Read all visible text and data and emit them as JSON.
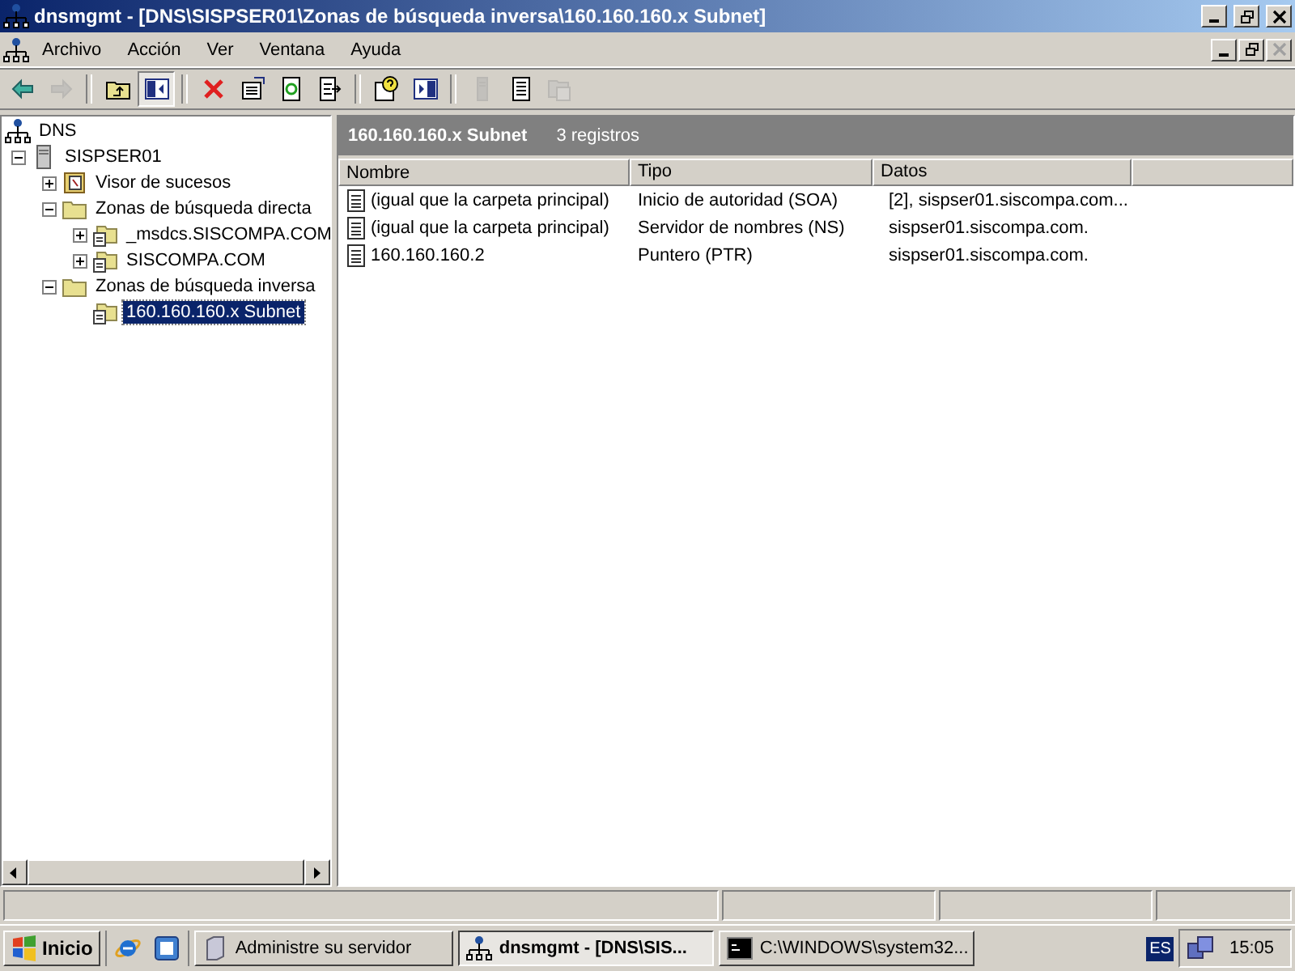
{
  "window": {
    "title": "dnsmgmt - [DNS\\SISPSER01\\Zonas de búsqueda inversa\\160.160.160.x Subnet]"
  },
  "menu": [
    "Archivo",
    "Acción",
    "Ver",
    "Ventana",
    "Ayuda"
  ],
  "toolbar": [
    {
      "kind": "back",
      "disabled": false
    },
    {
      "kind": "forward",
      "disabled": true
    },
    {
      "kind": "sep"
    },
    {
      "kind": "up",
      "disabled": false
    },
    {
      "kind": "tree",
      "disabled": false
    },
    {
      "kind": "sep"
    },
    {
      "kind": "delete",
      "disabled": false
    },
    {
      "kind": "properties",
      "disabled": false
    },
    {
      "kind": "refresh",
      "disabled": false
    },
    {
      "kind": "export",
      "disabled": false
    },
    {
      "kind": "sep"
    },
    {
      "kind": "help",
      "disabled": false
    },
    {
      "kind": "action",
      "disabled": false
    },
    {
      "kind": "sep"
    },
    {
      "kind": "server",
      "disabled": true
    },
    {
      "kind": "record",
      "disabled": false
    },
    {
      "kind": "domain",
      "disabled": true
    }
  ],
  "tree": [
    {
      "label": "DNS",
      "kind": "dns",
      "selected": false,
      "children": [
        {
          "label": "SISPSER01",
          "kind": "server",
          "expanded": true,
          "selected": false,
          "children": [
            {
              "label": "Visor de sucesos",
              "kind": "events",
              "expanded": false,
              "selected": false
            },
            {
              "label": "Zonas de búsqueda directa",
              "kind": "folder",
              "expanded": true,
              "selected": false,
              "children": [
                {
                  "label": "_msdcs.SISCOMPA.COM",
                  "kind": "zone",
                  "expanded": false,
                  "selected": false
                },
                {
                  "label": "SISCOMPA.COM",
                  "kind": "zone",
                  "expanded": false,
                  "selected": false
                }
              ]
            },
            {
              "label": "Zonas de búsqueda inversa",
              "kind": "folder",
              "expanded": true,
              "selected": false,
              "children": [
                {
                  "label": "160.160.160.x Subnet",
                  "kind": "zone",
                  "selected": true
                }
              ]
            }
          ]
        }
      ]
    }
  ],
  "details": {
    "title": "160.160.160.x Subnet",
    "count": "3 registros",
    "columns": [
      "Nombre",
      "Tipo",
      "Datos"
    ],
    "rows": [
      {
        "name": "(igual que la carpeta principal)",
        "type": "Inicio de autoridad (SOA)",
        "data": "[2], sispser01.siscompa.com..."
      },
      {
        "name": "(igual que la carpeta principal)",
        "type": "Servidor de nombres (NS)",
        "data": "sispser01.siscompa.com."
      },
      {
        "name": "160.160.160.2",
        "type": "Puntero (PTR)",
        "data": "sispser01.siscompa.com."
      }
    ]
  },
  "taskbar": {
    "start": "Inicio",
    "quick_launch": [
      {
        "kind": "browser"
      },
      {
        "kind": "outlook"
      }
    ],
    "tasks": [
      {
        "label": "Administre su servidor",
        "kind": "server",
        "selected": false
      },
      {
        "label": "dnsmgmt - [DNS\\SIS...",
        "kind": "dns",
        "selected": true
      },
      {
        "label": "C:\\WINDOWS\\system32...",
        "kind": "console",
        "selected": false
      }
    ],
    "language": "ES",
    "clock": "15:05"
  }
}
